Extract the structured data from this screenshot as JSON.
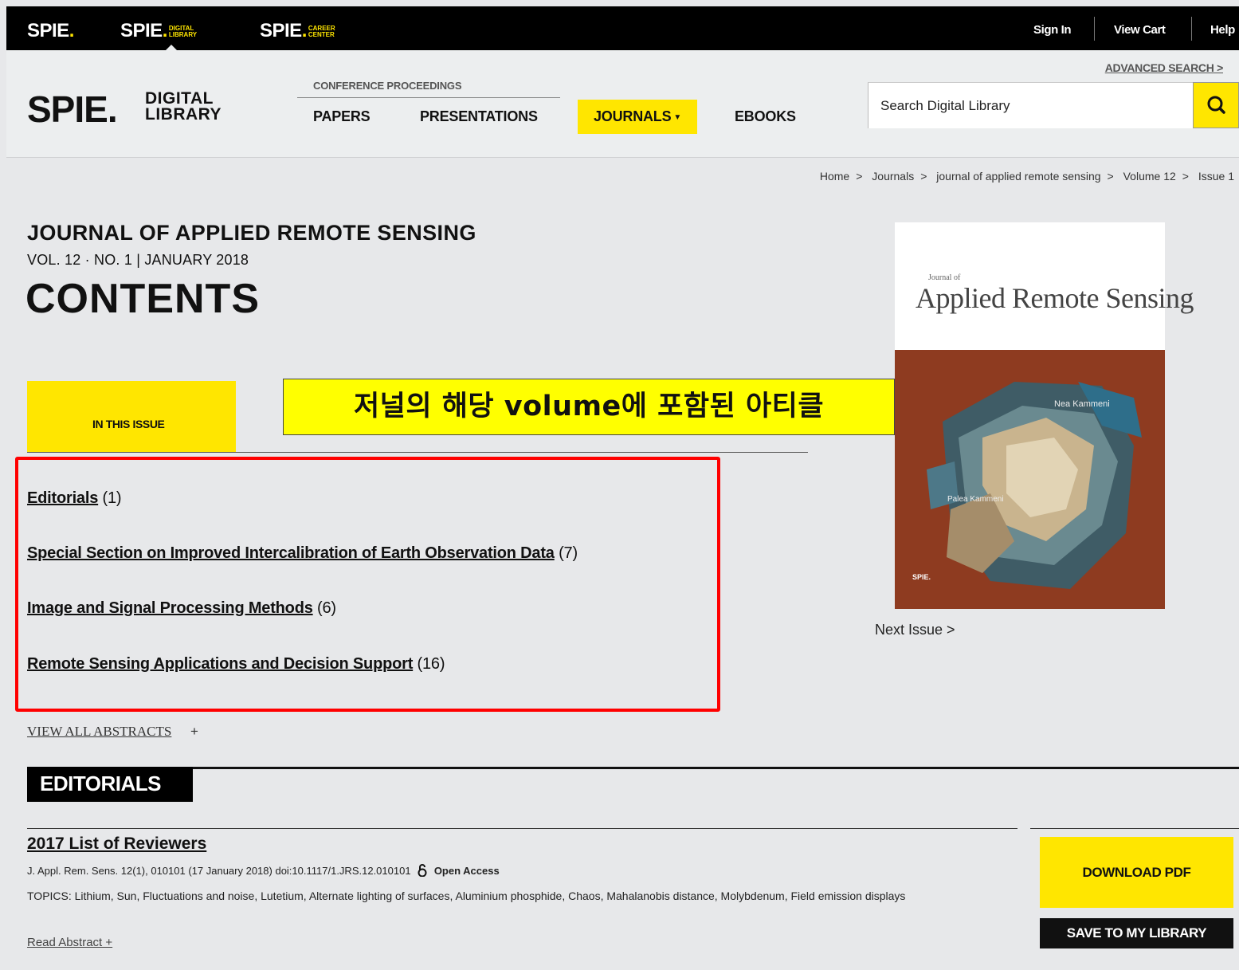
{
  "topbar": {
    "brands": [
      {
        "name": "SPIE",
        "sub": ""
      },
      {
        "name": "SPIE",
        "sub": "DIGITAL LIBRARY"
      },
      {
        "name": "SPIE",
        "sub": "CAREER CENTER"
      }
    ],
    "sign_in": "Sign In",
    "view_cart": "View Cart",
    "help": "Help"
  },
  "header": {
    "logo": "SPIE",
    "logo_sub1": "DIGITAL",
    "logo_sub2": "LIBRARY",
    "conference_proceedings": "CONFERENCE PROCEEDINGS",
    "nav": {
      "papers": "PAPERS",
      "presentations": "PRESENTATIONS",
      "journals": "JOURNALS",
      "ebooks": "EBOOKS"
    },
    "advanced_search": "ADVANCED SEARCH",
    "search_placeholder": "Search Digital Library"
  },
  "breadcrumb": [
    "Home",
    "Journals",
    "journal of applied remote sensing",
    "Volume 12",
    "Issue 1"
  ],
  "journal": {
    "title": "JOURNAL OF APPLIED REMOTE SENSING",
    "volume_line": "VOL. 12 · NO. 1 | JANUARY 2018",
    "heading": "CONTENTS"
  },
  "cover": {
    "journal_of": "Journal of",
    "title": "Applied Remote Sensing",
    "label1": "Nea Kammeni",
    "label2": "Palea Kammeni",
    "publisher": "SPIE."
  },
  "next_issue": "Next Issue >",
  "in_this_issue": "IN THIS ISSUE",
  "annotation": "저널의 해당 volume에 포함된 아티클",
  "sections": [
    {
      "name": "Editorials",
      "count": "(1)"
    },
    {
      "name": "Special Section on Improved Intercalibration of Earth Observation Data",
      "count": "(7)"
    },
    {
      "name": "Image and Signal Processing Methods",
      "count": "(6)"
    },
    {
      "name": "Remote Sensing Applications and Decision Support",
      "count": "(16)"
    }
  ],
  "view_all_abstracts": "VIEW ALL ABSTRACTS",
  "view_all_plus": "+",
  "editorials_heading": "EDITORIALS",
  "article": {
    "title": "2017 List of Reviewers",
    "meta": "J. Appl. Rem. Sens. 12(1), 010101 (17 January 2018) doi:10.1117/1.JRS.12.010101",
    "open_access": "Open Access",
    "topics": "TOPICS: Lithium, Sun, Fluctuations and noise, Lutetium, Alternate lighting of surfaces, Aluminium phosphide, Chaos, Mahalanobis distance, Molybdenum, Field emission displays",
    "read_abstract": "Read Abstract +",
    "download_pdf": "DOWNLOAD PDF",
    "save_to_library": "SAVE TO MY LIBRARY"
  },
  "colors": {
    "accent_yellow": "#ffe600",
    "annotation_red": "#ff0000"
  }
}
